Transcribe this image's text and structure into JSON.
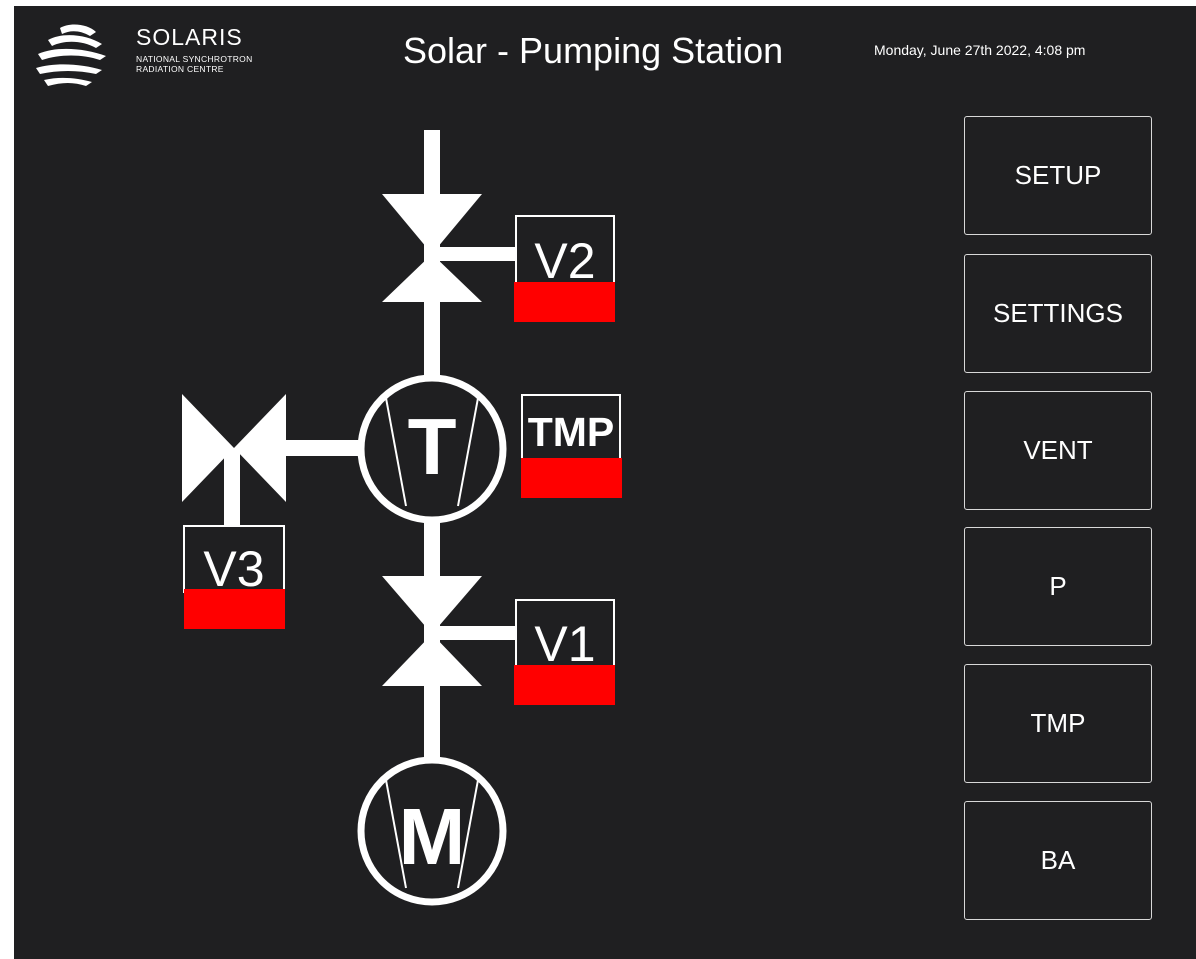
{
  "logo": {
    "name": "SOLARIS",
    "subtitle_line1": "NATIONAL SYNCHROTRON",
    "subtitle_line2": "RADIATION CENTRE",
    "icon": "solaris-logo-icon"
  },
  "header": {
    "title": "Solar - Pumping Station",
    "datetime": "Monday, June 27th 2022, 4:08 pm"
  },
  "diagram": {
    "valves": {
      "v2": {
        "label": "V2",
        "status_color": "#ff0000"
      },
      "v1": {
        "label": "V1",
        "status_color": "#ff0000"
      },
      "v3": {
        "label": "V3",
        "status_color": "#ff0000"
      }
    },
    "tmp": {
      "label": "TMP",
      "status_color": "#ff0000"
    },
    "turbo_pump": {
      "symbol": "T"
    },
    "motor_pump": {
      "symbol": "M"
    }
  },
  "nav": {
    "setup": "SETUP",
    "settings": "SETTINGS",
    "vent": "VENT",
    "p": "P",
    "tmp": "TMP",
    "ba": "BA"
  },
  "colors": {
    "background": "#1f1f21",
    "foreground": "#ffffff",
    "alarm": "#ff0000"
  }
}
